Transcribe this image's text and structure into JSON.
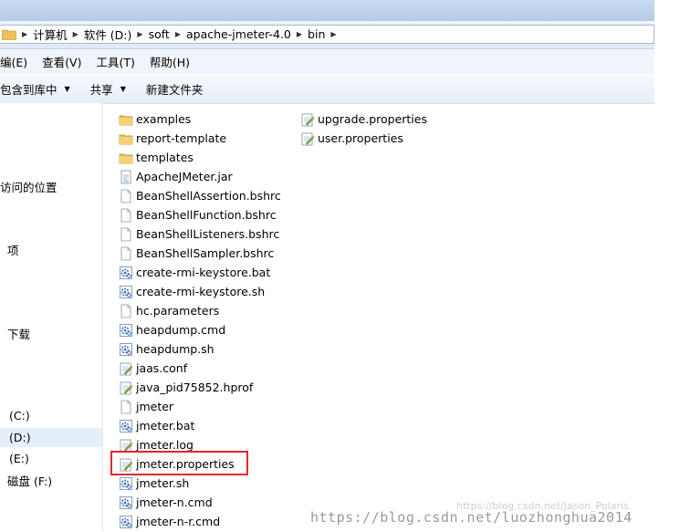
{
  "address": {
    "crumbs": [
      {
        "label": "计算机"
      },
      {
        "label": "软件 (D:)"
      },
      {
        "label": "soft"
      },
      {
        "label": "apache-jmeter-4.0"
      },
      {
        "label": "bin"
      }
    ]
  },
  "menu": [
    "编(E)",
    "查看(V)",
    "工具(T)",
    "帮助(H)"
  ],
  "toolbar": {
    "include_label": "包含到库中",
    "share_label": "共享",
    "newfolder_label": "新建文件夹"
  },
  "nav": {
    "recent": "访问的位置",
    "item2": "项",
    "download": "下载",
    "c_drive": "(C:)",
    "d_drive": "(D:)",
    "e_drive": "(E:)",
    "f_drive": "磁盘 (F:)"
  },
  "files": {
    "col1": [
      {
        "name": "examples",
        "icon": "folder-icon"
      },
      {
        "name": "report-template",
        "icon": "folder-icon"
      },
      {
        "name": "templates",
        "icon": "folder-icon"
      },
      {
        "name": "ApacheJMeter.jar",
        "icon": "jar-icon"
      },
      {
        "name": "BeanShellAssertion.bshrc",
        "icon": "file-icon"
      },
      {
        "name": "BeanShellFunction.bshrc",
        "icon": "file-icon"
      },
      {
        "name": "BeanShellListeners.bshrc",
        "icon": "file-icon"
      },
      {
        "name": "BeanShellSampler.bshrc",
        "icon": "file-icon"
      },
      {
        "name": "create-rmi-keystore.bat",
        "icon": "gear-file-icon"
      },
      {
        "name": "create-rmi-keystore.sh",
        "icon": "gear-file-icon"
      },
      {
        "name": "hc.parameters",
        "icon": "file-icon"
      },
      {
        "name": "heapdump.cmd",
        "icon": "gear-file-icon"
      },
      {
        "name": "heapdump.sh",
        "icon": "gear-file-icon"
      },
      {
        "name": "jaas.conf",
        "icon": "notepad-icon"
      },
      {
        "name": "java_pid75852.hprof",
        "icon": "notepad-icon"
      },
      {
        "name": "jmeter",
        "icon": "file-icon"
      },
      {
        "name": "jmeter.bat",
        "icon": "gear-file-icon"
      },
      {
        "name": "jmeter.log",
        "icon": "notepad-icon"
      },
      {
        "name": "jmeter.properties",
        "icon": "notepad-icon"
      },
      {
        "name": "jmeter.sh",
        "icon": "gear-file-icon"
      },
      {
        "name": "jmeter-n.cmd",
        "icon": "gear-file-icon"
      },
      {
        "name": "jmeter-n-r.cmd",
        "icon": "gear-file-icon"
      }
    ],
    "col2": [
      {
        "name": "upgrade.properties",
        "icon": "notepad-icon"
      },
      {
        "name": "user.properties",
        "icon": "notepad-icon"
      }
    ]
  },
  "watermark": "https://blog.csdn.net/luozhonghua2014",
  "watermark_faint": "https://blog.csdn.net/Jason_Polaris",
  "colors": {
    "highlight": "#e0282b",
    "nav_selected": "#e5eefb"
  }
}
